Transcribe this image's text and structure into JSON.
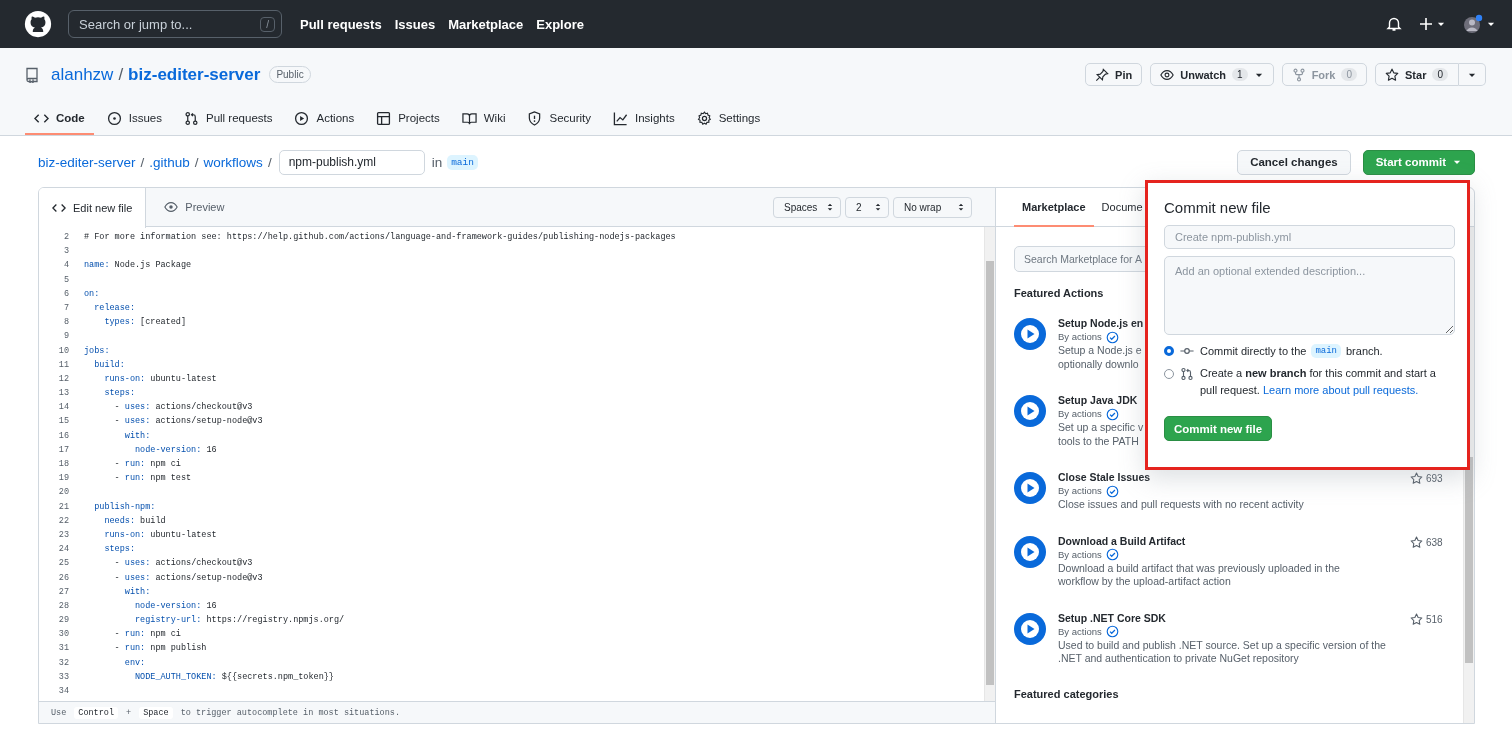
{
  "topbar": {
    "search_placeholder": "Search or jump to...",
    "search_key": "/",
    "nav": [
      "Pull requests",
      "Issues",
      "Marketplace",
      "Explore"
    ]
  },
  "repo": {
    "owner": "alanhzw",
    "separator": "/",
    "name": "biz-editer-server",
    "visibility": "Public",
    "actions": [
      {
        "kind": "pin",
        "label": "Pin",
        "disabled": false
      },
      {
        "kind": "watch",
        "label": "Unwatch",
        "count": "1",
        "menu": true,
        "disabled": false
      },
      {
        "kind": "fork",
        "label": "Fork",
        "count": "0",
        "disabled": true
      },
      {
        "kind": "star",
        "label": "Star",
        "count": "0",
        "menu": true,
        "disabled": false
      }
    ]
  },
  "repo_tabs": [
    {
      "label": "Code",
      "selected": true
    },
    {
      "label": "Issues",
      "selected": false
    },
    {
      "label": "Pull requests",
      "selected": false
    },
    {
      "label": "Actions",
      "selected": false
    },
    {
      "label": "Projects",
      "selected": false
    },
    {
      "label": "Wiki",
      "selected": false
    },
    {
      "label": "Security",
      "selected": false
    },
    {
      "label": "Insights",
      "selected": false
    },
    {
      "label": "Settings",
      "selected": false
    }
  ],
  "breadcrumb": {
    "path": [
      "biz-editer-server",
      ".github",
      "workflows"
    ],
    "separator": "/",
    "filename": "npm-publish.yml",
    "in_label": "in",
    "branch": "main"
  },
  "header_buttons": [
    {
      "kind": "secondary",
      "label": "Cancel changes"
    },
    {
      "kind": "primary",
      "label": "Start commit",
      "menu": true
    }
  ],
  "editor": {
    "tabs": [
      {
        "label": "Edit new file",
        "selected": true
      },
      {
        "label": "Preview",
        "selected": false
      }
    ],
    "selects": [
      "Spaces",
      "2",
      "No wrap"
    ],
    "lines": [
      {
        "line_no": "2",
        "comment": "# For more information see: https://help.github.com/actions/language-and-framework-guides/publishing-nodejs-packages"
      },
      {
        "line_no": "3"
      },
      {
        "line_no": "4",
        "key": "name:",
        "value": " Node.js Package"
      },
      {
        "line_no": "5"
      },
      {
        "line_no": "6",
        "key": "on:"
      },
      {
        "line_no": "7",
        "key": "  release:"
      },
      {
        "line_no": "8",
        "key": "    types:",
        "value": " [created]"
      },
      {
        "line_no": "9"
      },
      {
        "line_no": "10",
        "key": "jobs:"
      },
      {
        "line_no": "11",
        "key": "  build:"
      },
      {
        "line_no": "12",
        "key": "    runs-on:",
        "value": " ubuntu-latest"
      },
      {
        "line_no": "13",
        "key": "    steps:"
      },
      {
        "line_no": "14",
        "lead": "      - ",
        "key": "uses:",
        "value": " actions/checkout@v3"
      },
      {
        "line_no": "15",
        "lead": "      - ",
        "key": "uses:",
        "value": " actions/setup-node@v3"
      },
      {
        "line_no": "16",
        "key": "        with:"
      },
      {
        "line_no": "17",
        "key": "          node-version:",
        "value": " 16"
      },
      {
        "line_no": "18",
        "lead": "      - ",
        "key": "run:",
        "value": " npm ci"
      },
      {
        "line_no": "19",
        "lead": "      - ",
        "key": "run:",
        "value": " npm test"
      },
      {
        "line_no": "20"
      },
      {
        "line_no": "21",
        "key": "  publish-npm:"
      },
      {
        "line_no": "22",
        "key": "    needs:",
        "value": " build"
      },
      {
        "line_no": "23",
        "key": "    runs-on:",
        "value": " ubuntu-latest"
      },
      {
        "line_no": "24",
        "key": "    steps:"
      },
      {
        "line_no": "25",
        "lead": "      - ",
        "key": "uses:",
        "value": " actions/checkout@v3"
      },
      {
        "line_no": "26",
        "lead": "      - ",
        "key": "uses:",
        "value": " actions/setup-node@v3"
      },
      {
        "line_no": "27",
        "key": "        with:"
      },
      {
        "line_no": "28",
        "key": "          node-version:",
        "value": " 16"
      },
      {
        "line_no": "29",
        "key": "          registry-url:",
        "value": " https://registry.npmjs.org/"
      },
      {
        "line_no": "30",
        "lead": "      - ",
        "key": "run:",
        "value": " npm ci"
      },
      {
        "line_no": "31",
        "lead": "      - ",
        "key": "run:",
        "value": " npm publish"
      },
      {
        "line_no": "32",
        "key": "        env:"
      },
      {
        "line_no": "33",
        "key": "          NODE_AUTH_TOKEN:",
        "value": " ${{secrets.npm_token}}"
      },
      {
        "line_no": "34"
      }
    ],
    "footer": [
      {
        "kind": "text",
        "text": "Use"
      },
      {
        "kind": "key",
        "text": "Control"
      },
      {
        "kind": "text",
        "text": "+"
      },
      {
        "kind": "key",
        "text": "Space"
      },
      {
        "kind": "text",
        "text": "to trigger autocomplete in most situations."
      }
    ]
  },
  "sidebar": {
    "tabs": [
      {
        "label": "Marketplace",
        "selected": true
      },
      {
        "label": "Docume",
        "selected": false
      }
    ],
    "search_placeholder": "Search Marketplace for A",
    "featured_title": "Featured Actions",
    "actions": [
      {
        "title": "Setup Node.js en",
        "by": "By actions",
        "verified": true,
        "description_lines": [
          "Setup a Node.js e",
          "optionally downlo"
        ]
      },
      {
        "title": "Setup Java JDK",
        "by": "By actions",
        "verified": true,
        "description_lines": [
          "Set up a specific v",
          "tools to the PATH"
        ]
      },
      {
        "title": "Close Stale Issues",
        "by": "By actions",
        "verified": true,
        "star_count": "693",
        "description_lines": [
          "Close issues and pull requests with no recent activity"
        ]
      },
      {
        "title": "Download a Build Artifact",
        "by": "By actions",
        "verified": true,
        "star_count": "638",
        "description_lines": [
          "Download a build artifact that was previously uploaded in the",
          "workflow by the upload-artifact action"
        ]
      },
      {
        "title": "Setup .NET Core SDK",
        "by": "By actions",
        "verified": true,
        "star_count": "516",
        "description_lines": [
          "Used to build and publish .NET source. Set up a specific version of the",
          ".NET and authentication to private NuGet repository"
        ]
      }
    ],
    "categories_title": "Featured categories"
  },
  "commit_dialog": {
    "title": "Commit new file",
    "summary_placeholder": "Create npm-publish.yml",
    "description_placeholder": "Add an optional extended description...",
    "options": [
      {
        "selected": true,
        "text_before": "Commit directly to the",
        "branch": "main",
        "text_after": "branch."
      },
      {
        "selected": false,
        "text": "Create a **new branch** for this commit and start a pull request.",
        "link": "Learn more about pull requests."
      }
    ],
    "button": "Commit new file"
  }
}
